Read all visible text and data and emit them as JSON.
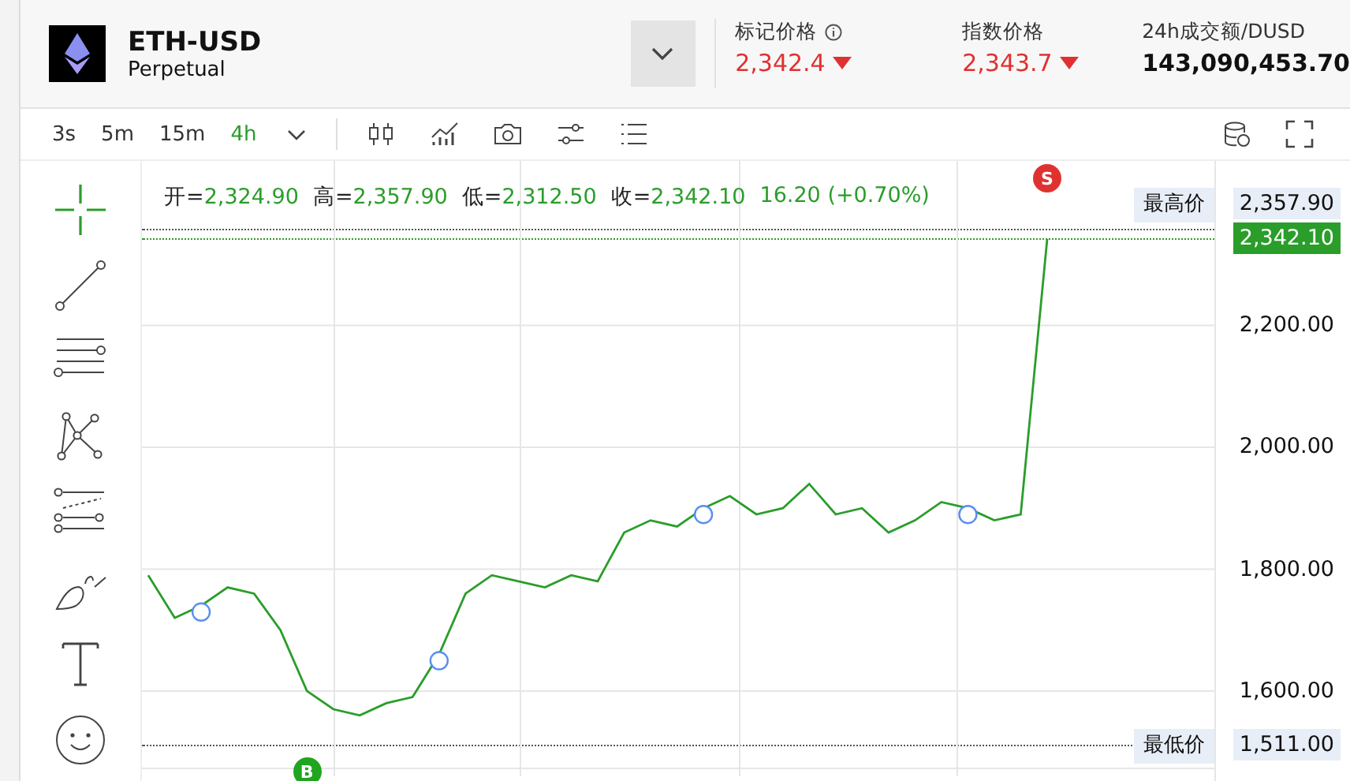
{
  "header": {
    "symbol": "ETH-USD",
    "subtitle": "Perpetual",
    "stats": [
      {
        "label": "标记价格",
        "info": true,
        "value": "2,342.4",
        "down": true
      },
      {
        "label": "指数价格",
        "info": false,
        "value": "2,343.7",
        "down": true
      },
      {
        "label": "24h成交额/DUSD",
        "info": false,
        "value": "143,090,453.70",
        "down": false
      }
    ]
  },
  "toolbar": {
    "intervals": [
      {
        "label": "3s",
        "selected": false
      },
      {
        "label": "5m",
        "selected": false
      },
      {
        "label": "15m",
        "selected": false
      },
      {
        "label": "4h",
        "selected": true
      }
    ]
  },
  "tools": [
    {
      "kind": "crosshair",
      "selected": true
    },
    {
      "kind": "trendline",
      "selected": false
    },
    {
      "kind": "hlines",
      "selected": false
    },
    {
      "kind": "pattern",
      "selected": false
    },
    {
      "kind": "fib",
      "selected": false
    },
    {
      "kind": "brush",
      "selected": false
    },
    {
      "kind": "text",
      "selected": false
    },
    {
      "kind": "emoji",
      "selected": false
    }
  ],
  "legend": {
    "items": [
      {
        "label": "开=",
        "value": "2,324.90"
      },
      {
        "label": "高=",
        "value": "2,357.90"
      },
      {
        "label": "低=",
        "value": "2,312.50"
      },
      {
        "label": "收=",
        "value": "2,342.10"
      }
    ],
    "change": "16.20 (+0.70%)"
  },
  "chart": {
    "chart_data": {
      "type": "line",
      "grid": true,
      "ylim": [
        1460,
        2470
      ],
      "yticks": [
        {
          "value": 1600,
          "label": "1,600.00"
        },
        {
          "value": 1800,
          "label": "1,800.00"
        },
        {
          "value": 2000,
          "label": "2,000.00"
        },
        {
          "value": 2200,
          "label": "2,200.00"
        }
      ],
      "series": [
        {
          "color": "#2a9d2a",
          "values": [
            1790,
            1720,
            1740,
            1770,
            1760,
            1700,
            1600,
            1570,
            1560,
            1580,
            1590,
            1660,
            1760,
            1790,
            1780,
            1770,
            1790,
            1780,
            1860,
            1880,
            1870,
            1900,
            1920,
            1890,
            1900,
            1940,
            1890,
            1900,
            1860,
            1880,
            1910,
            1900,
            1880,
            1890,
            2342
          ]
        }
      ]
    },
    "markers": [
      {
        "label": "B",
        "color": "#1fa51f"
      },
      {
        "label": "S",
        "color": "#e03131"
      }
    ],
    "levels": [
      {
        "label": "2,357.90"
      },
      {
        "label": "2,342.10"
      },
      {
        "label": "1,511.00"
      }
    ],
    "high_label": "最高价",
    "low_label": "最低价"
  }
}
